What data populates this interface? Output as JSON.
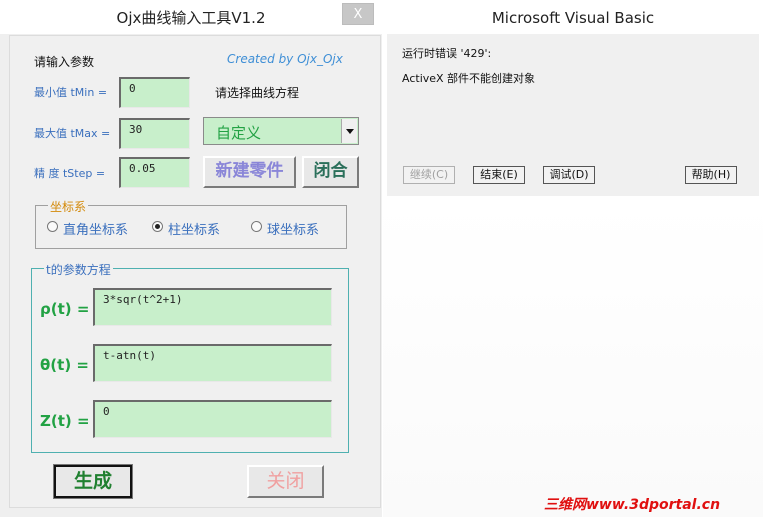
{
  "tool": {
    "title": "Ojx曲线输入工具V1.2",
    "close_label": "X",
    "prompt_params": "请输入参数",
    "credit": "Created by Ojx_Ojx",
    "tmin_label": "最小值 tMin =",
    "tmin_value": "0",
    "tmax_label": "最大值 tMax =",
    "tmax_value": "30",
    "tstep_label": "精 度 tStep =",
    "tstep_value": "0.05",
    "select_curve_prompt": "请选择曲线方程",
    "curve_select_value": "自定义",
    "new_part_button": "新建零件",
    "close_shape_button": "闭合",
    "coord_group_title": "坐标系",
    "coord_options": [
      "直角坐标系",
      "柱坐标系",
      "球坐标系"
    ],
    "coord_selected": 1,
    "eq_group_title": "t的参数方程",
    "rho_label": "ρ(t) =",
    "rho_value": "3*sqr(t^2+1)",
    "theta_label": "θ(t) =",
    "theta_value": "t-atn(t)",
    "z_label": "Z(t) =",
    "z_value": "0",
    "generate_button": "生成",
    "close_button": "关闭"
  },
  "vb_dialog": {
    "title": "Microsoft Visual Basic",
    "error_line": "运行时错误 '429':",
    "error_message": "ActiveX 部件不能创建对象",
    "buttons": {
      "continue": "继续(C)",
      "end": "结束(E)",
      "debug": "调试(D)",
      "help": "帮助(H)"
    }
  },
  "watermark": "三维网www.3dportal.cn",
  "colors": {
    "field_green": "#c8efcb",
    "label_blue": "#3a6fbd",
    "group_orange": "#d48a0a",
    "equation_green": "#22a244",
    "button_purple": "#8a86d8",
    "close_disabled_red": "#f0a0a0"
  }
}
